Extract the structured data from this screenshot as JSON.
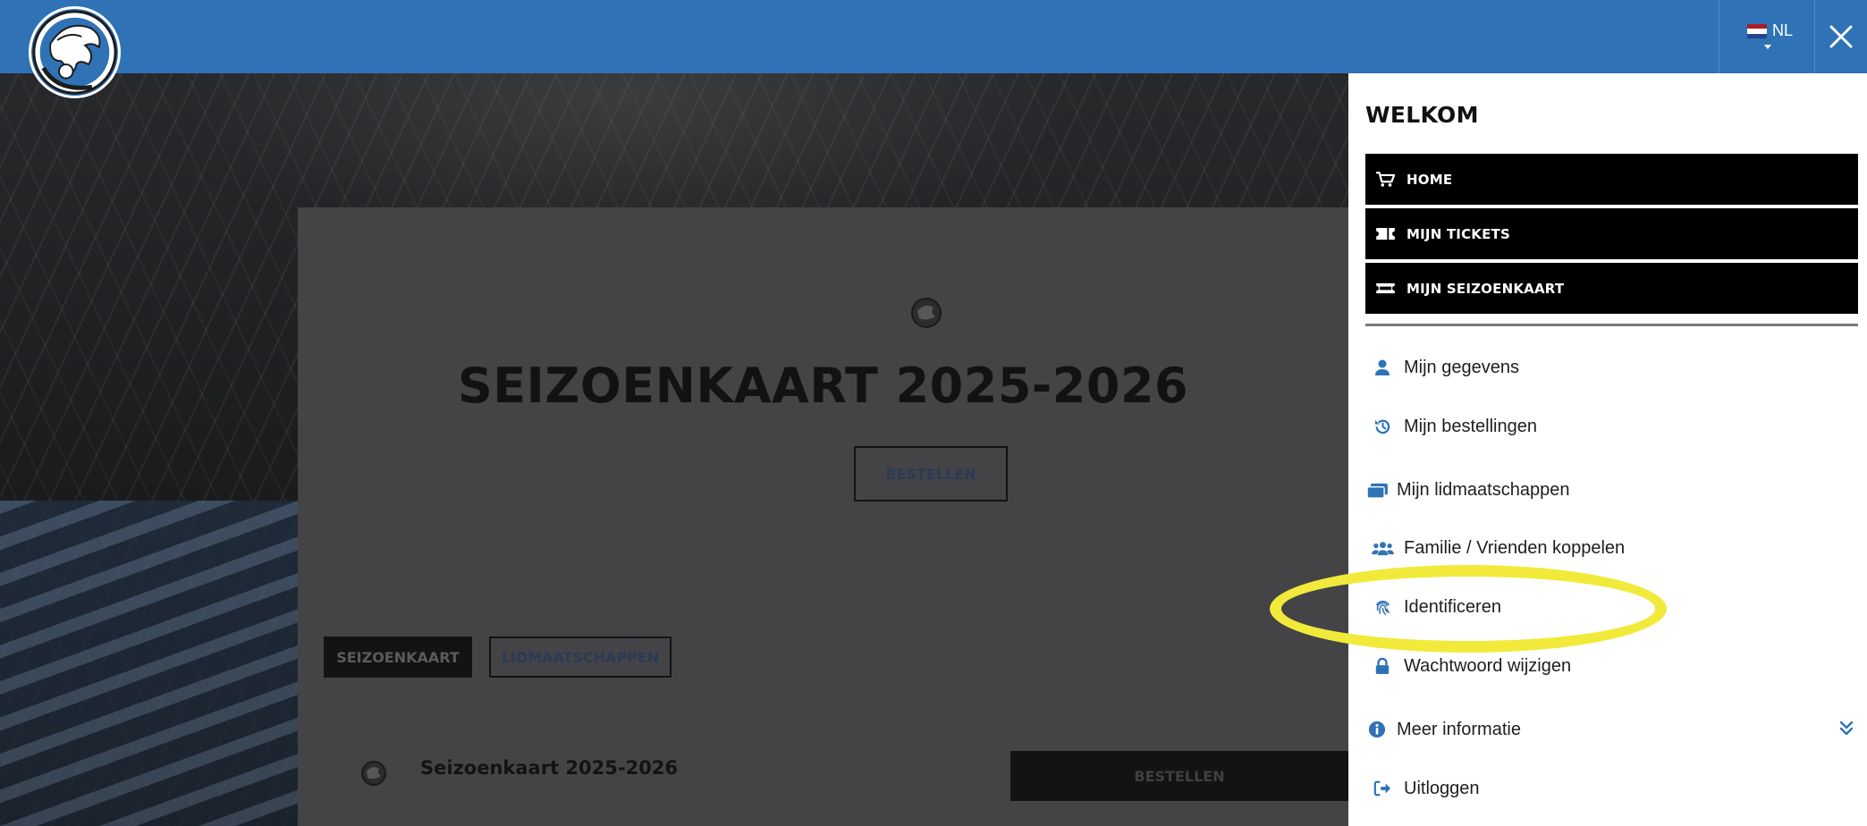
{
  "header": {
    "logo_icon": "fc-den-bosch-dragon-logo",
    "language": {
      "code": "NL",
      "flag": "netherlands-flag-icon",
      "flag_colors": [
        "#ae1c28",
        "#ffffff",
        "#21468b"
      ]
    },
    "close_icon": "close-icon",
    "bar_color": "#2f73b6"
  },
  "main": {
    "title": "SEIZOENKAART 2025-2026",
    "order_button": "BESTELLEN",
    "tabs": [
      {
        "label": "SEIZOENKAART",
        "active": true
      },
      {
        "label": "LIDMAATSCHAPPEN",
        "active": false
      }
    ],
    "product_row": {
      "title": "Seizoenkaart 2025-2026",
      "button": "BESTELLEN"
    }
  },
  "menu": {
    "heading": "WELKOM",
    "primary": [
      {
        "label": "HOME",
        "icon": "cart-icon"
      },
      {
        "label": "MIJN TICKETS",
        "icon": "ticket-icon"
      },
      {
        "label": "MIJN SEIZOENKAART",
        "icon": "season-card-icon"
      }
    ],
    "links": [
      {
        "label": "Mijn gegevens",
        "icon": "user-icon"
      },
      {
        "label": "Mijn bestellingen",
        "icon": "history-icon"
      },
      {
        "label": "Mijn lidmaatschappen",
        "icon": "membership-card-icon"
      },
      {
        "label": "Familie / Vrienden koppelen",
        "icon": "users-icon"
      },
      {
        "label": "Identificeren",
        "icon": "fingerprint-icon",
        "highlighted": true
      },
      {
        "label": "Wachtwoord wijzigen",
        "icon": "lock-icon"
      },
      {
        "label": "Meer informatie",
        "icon": "info-icon",
        "expandable": true,
        "chevron": "chevron-double-down-icon"
      },
      {
        "label": "Uitloggen",
        "icon": "logout-icon"
      }
    ],
    "accent_color": "#2f73b6",
    "highlight_color": "#f1ea3a"
  }
}
